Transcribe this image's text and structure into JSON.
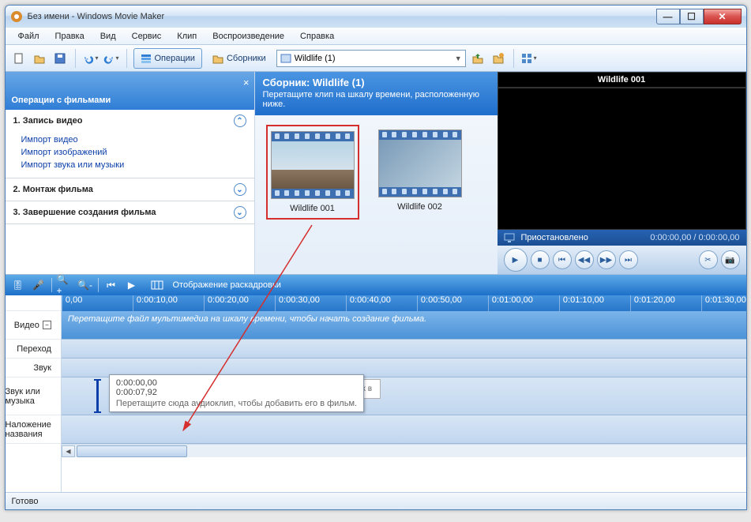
{
  "titlebar": {
    "title": "Без имени - Windows Movie Maker"
  },
  "menu": {
    "items": [
      "Файл",
      "Правка",
      "Вид",
      "Сервис",
      "Клип",
      "Воспроизведение",
      "Справка"
    ]
  },
  "toolbar": {
    "operations_label": "Операции",
    "collections_label": "Сборники",
    "combo_value": "Wildlife (1)"
  },
  "tasks": {
    "header": "Операции с фильмами",
    "group1": {
      "title": "1. Запись видео",
      "links": [
        "Импорт видео",
        "Импорт изображений",
        "Импорт звука или музыки"
      ]
    },
    "group2": {
      "title": "2. Монтаж фильма"
    },
    "group3": {
      "title": "3. Завершение создания фильма"
    }
  },
  "collections": {
    "title": "Сборник: Wildlife (1)",
    "subtitle": "Перетащите клип на шкалу времени, расположенную ниже.",
    "thumbs": [
      {
        "label": "Wildlife 001"
      },
      {
        "label": "Wildlife 002"
      }
    ]
  },
  "preview": {
    "title": "Wildlife 001",
    "status": "Приостановлено",
    "time": "0:00:00,00 / 0:00:00,00"
  },
  "timeline": {
    "view_label": "Отображение раскадровки",
    "ruler": [
      "0,00",
      "0:00:10,00",
      "0:00:20,00",
      "0:00:30,00",
      "0:00:40,00",
      "0:00:50,00",
      "0:01:00,00",
      "0:01:10,00",
      "0:01:20,00",
      "0:01:30,00"
    ],
    "rows": {
      "video": "Видео",
      "transition": "Переход",
      "audio": "Звук",
      "audio_music": "Звук или музыка",
      "title_overlay": "Наложение названия"
    },
    "video_hint": "Перетащите файл мультимедиа на шкалу времени, чтобы начать создание фильма.",
    "tooltip": {
      "t1": "0:00:00,00",
      "t2": "0:00:07,92",
      "t3": "Перетащите сюда аудиоклип, чтобы добавить его в фильм."
    },
    "drag_hint": "вить их в"
  },
  "status": "Готово"
}
